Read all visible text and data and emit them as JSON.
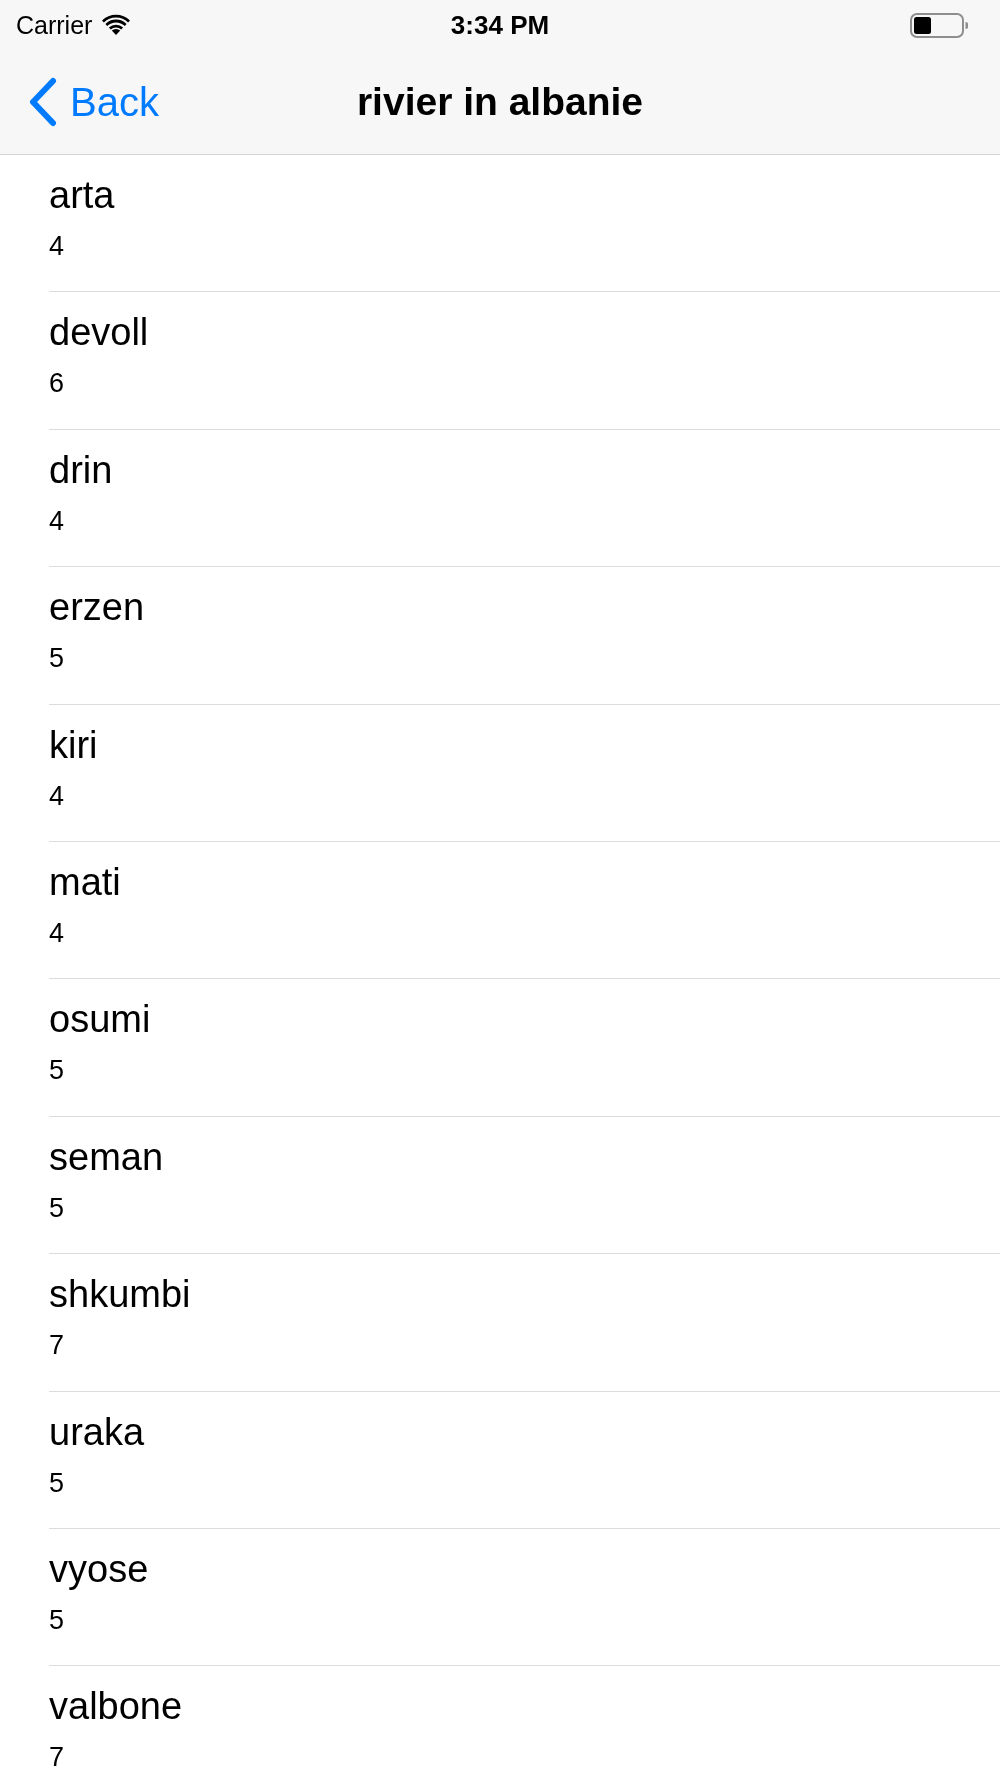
{
  "status_bar": {
    "carrier": "Carrier",
    "time": "3:34 PM"
  },
  "nav_bar": {
    "back_label": "Back",
    "title": "rivier in albanie"
  },
  "rows": [
    {
      "title": "arta",
      "subtitle": "4"
    },
    {
      "title": "devoll",
      "subtitle": "6"
    },
    {
      "title": "drin",
      "subtitle": "4"
    },
    {
      "title": "erzen",
      "subtitle": "5"
    },
    {
      "title": "kiri",
      "subtitle": "4"
    },
    {
      "title": "mati",
      "subtitle": "4"
    },
    {
      "title": "osumi",
      "subtitle": "5"
    },
    {
      "title": "seman",
      "subtitle": "5"
    },
    {
      "title": "shkumbi",
      "subtitle": "7"
    },
    {
      "title": "uraka",
      "subtitle": "5"
    },
    {
      "title": "vyose",
      "subtitle": "5"
    },
    {
      "title": "valbone",
      "subtitle": "7"
    }
  ]
}
